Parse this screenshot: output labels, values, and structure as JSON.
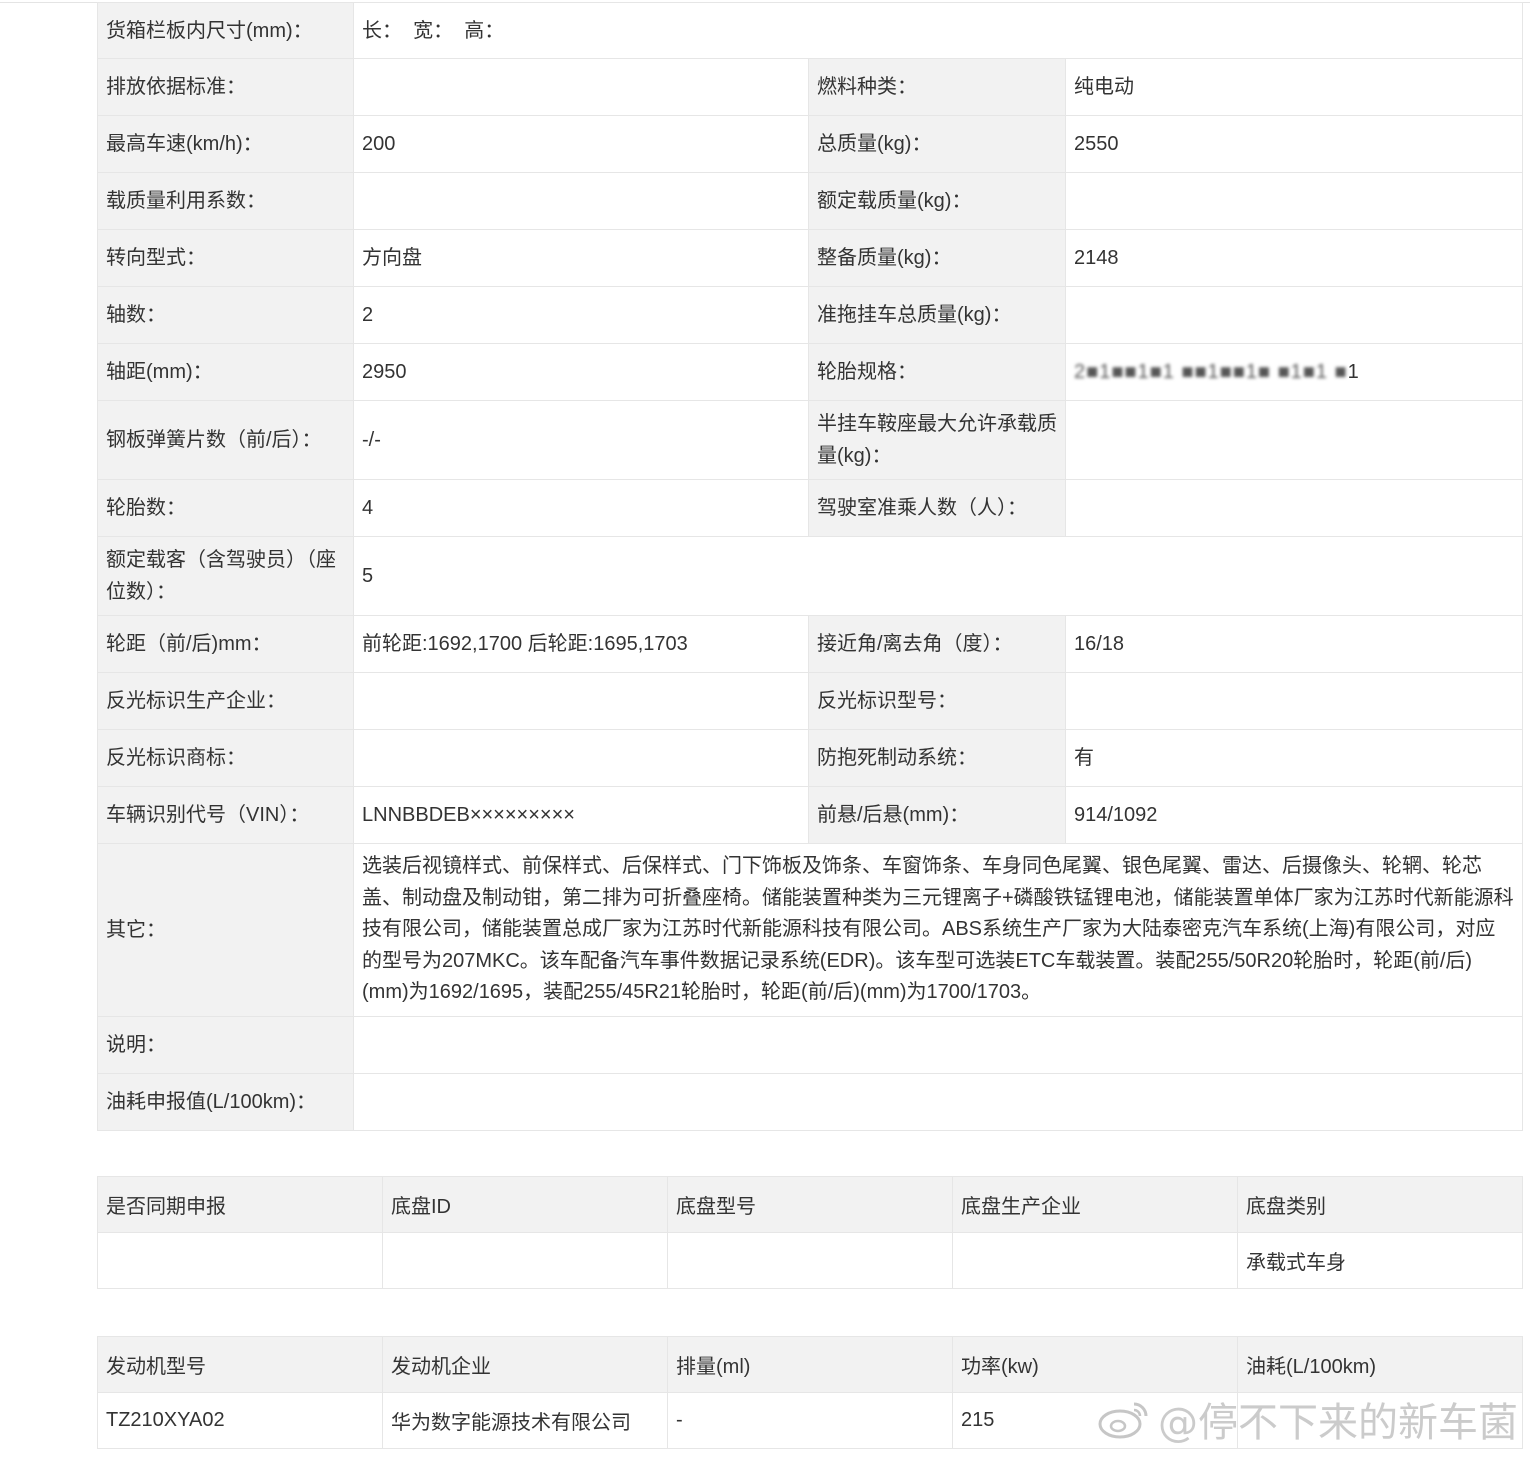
{
  "spec_rows": [
    {
      "l1": "货箱栏板内尺寸(mm)：",
      "v1": "长：  宽：  高：",
      "colspan": true
    },
    {
      "l1": "排放依据标准：",
      "v1": "",
      "l2": "燃料种类：",
      "v2": "纯电动"
    },
    {
      "l1": "最高车速(km/h)：",
      "v1": "200",
      "l2": "总质量(kg)：",
      "v2": "2550"
    },
    {
      "l1": "载质量利用系数：",
      "v1": "",
      "l2": "额定载质量(kg)：",
      "v2": ""
    },
    {
      "l1": "转向型式：",
      "v1": "方向盘",
      "l2": "整备质量(kg)：",
      "v2": "2148"
    },
    {
      "l1": "轴数：",
      "v1": "2",
      "l2": "准拖挂车总质量(kg)：",
      "v2": ""
    },
    {
      "l1": "轴距(mm)：",
      "v1": "2950",
      "l2": "轮胎规格：",
      "v2": "1"
    },
    {
      "l1": "钢板弹簧片数（前/后）：",
      "v1": "-/-",
      "l2": "半挂车鞍座最大允许承载质量(kg)：",
      "v2": ""
    },
    {
      "l1": "轮胎数：",
      "v1": "4",
      "l2": "驾驶室准乘人数（人）：",
      "v2": ""
    },
    {
      "l1": "额定载客（含驾驶员）（座位数）：",
      "v1": "5",
      "colspan": true
    },
    {
      "l1": "轮距（前/后)mm：",
      "v1": "前轮距:1692,1700 后轮距:1695,1703",
      "l2": "接近角/离去角（度）：",
      "v2": "16/18"
    },
    {
      "l1": "反光标识生产企业：",
      "v1": "",
      "l2": "反光标识型号：",
      "v2": ""
    },
    {
      "l1": "反光标识商标：",
      "v1": "",
      "l2": "防抱死制动系统：",
      "v2": "有"
    },
    {
      "l1": "车辆识别代号（VIN）：",
      "v1": "LNNBBDEB×××××××××",
      "l2": "前悬/后悬(mm)：",
      "v2": "914/1092"
    },
    {
      "l1": "其它：",
      "v1": "选装后视镜样式、前保样式、后保样式、门下饰板及饰条、车窗饰条、车身同色尾翼、银色尾翼、雷达、后摄像头、轮辋、轮芯盖、制动盘及制动钳，第二排为可折叠座椅。储能装置种类为三元锂离子+磷酸铁锰锂电池，储能装置单体厂家为江苏时代新能源科技有限公司，储能装置总成厂家为江苏时代新能源科技有限公司。ABS系统生产厂家为大陆泰密克汽车系统(上海)有限公司，对应的型号为207MKC。该车配备汽车事件数据记录系统(EDR)。该车型可选装ETC车载装置。装配255/50R20轮胎时，轮距(前/后)(mm)为1692/1695，装配255/45R21轮胎时，轮距(前/后)(mm)为1700/1703。",
      "colspan": true
    },
    {
      "l1": "说明：",
      "v1": "",
      "colspan": true
    },
    {
      "l1": "油耗申报值(L/100km)：",
      "v1": "",
      "colspan": true
    }
  ],
  "chassis_table": {
    "headers": [
      "是否同期申报",
      "底盘ID",
      "底盘型号",
      "底盘生产企业",
      "底盘类别"
    ],
    "rows": [
      [
        "",
        "",
        "",
        "",
        "承载式车身"
      ]
    ]
  },
  "engine_table": {
    "headers": [
      "发动机型号",
      "发动机企业",
      "排量(ml)",
      "功率(kw)",
      "油耗(L/100km)"
    ],
    "rows": [
      [
        "TZ210XYA02",
        "华为数字能源技术有限公司",
        "-",
        "215",
        ""
      ]
    ]
  },
  "watermark": {
    "text": "@停不下来的新车菌",
    "icon": "weibo-icon"
  }
}
